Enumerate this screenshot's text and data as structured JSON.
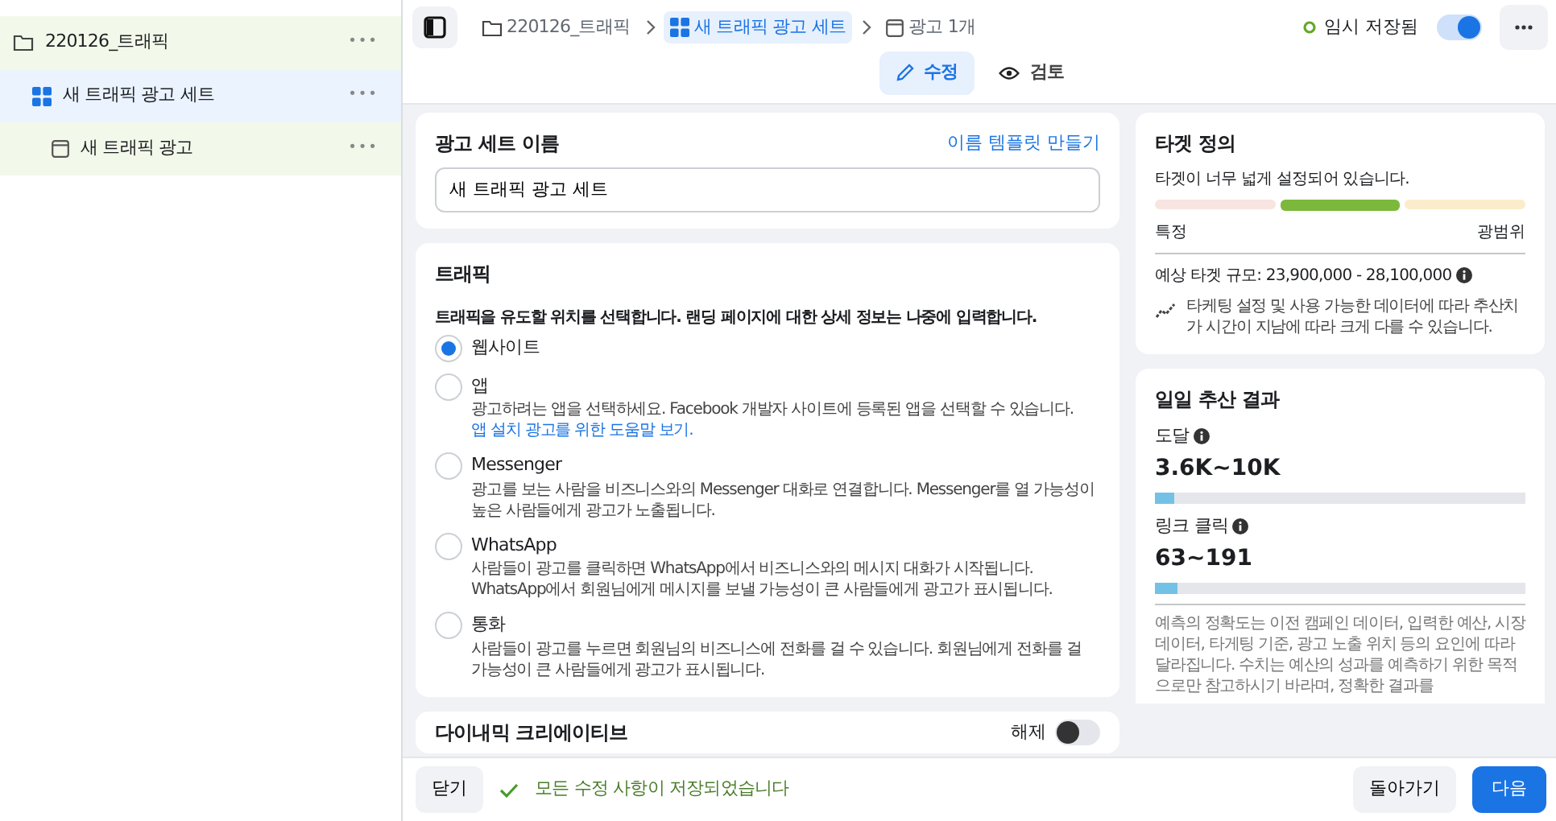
{
  "sidebar": {
    "items": [
      {
        "label": "220126_트래픽",
        "selected": false,
        "kind": "campaign",
        "more": "•••",
        "children": [
          {
            "label": "새 트래픽 광고 세트",
            "selected": true,
            "kind": "adset",
            "more": "•••",
            "children": [
              {
                "label": "새 트래픽 광고",
                "selected": false,
                "kind": "ad",
                "more": "•••"
              }
            ]
          }
        ]
      }
    ]
  },
  "header": {
    "breadcrumb": [
      {
        "label": "220126_트래픽",
        "kind": "campaign",
        "selected": false
      },
      {
        "label": "새 트래픽 광고 세트",
        "kind": "adset",
        "selected": true
      },
      {
        "label": "광고 1개",
        "kind": "ad",
        "selected": false
      }
    ],
    "save_status": "임시 저장됨",
    "toggle_on": true,
    "tabs": [
      {
        "label": "수정",
        "kind": "edit",
        "selected": true
      },
      {
        "label": "검토",
        "kind": "review",
        "selected": false
      }
    ]
  },
  "name_card": {
    "title": "광고 세트 이름",
    "link": "이름 템플릿 만들기",
    "value": "새 트래픽 광고 세트"
  },
  "traffic_card": {
    "title": "트래픽",
    "prompt": "트래픽을 유도할 위치를 선택합니다. 랜딩 페이지에 대한 상세 정보는 나중에 입력합니다.",
    "options": [
      {
        "label": "웹사이트",
        "selected": true
      },
      {
        "label": "앱",
        "selected": false,
        "description": "광고하려는 앱을 선택하세요. Facebook 개발자 사이트에 등록된 앱을 선택할 수 있습니다.",
        "link": "앱 설치 광고를 위한 도움말 보기."
      },
      {
        "label": "Messenger",
        "selected": false,
        "description": "광고를 보는 사람을 비즈니스와의 Messenger 대화로 연결합니다. Messenger를 열 가능성이 높은 사람들에게 광고가 노출됩니다."
      },
      {
        "label": "WhatsApp",
        "selected": false,
        "description": "사람들이 광고를 클릭하면 WhatsApp에서 비즈니스와의 메시지 대화가 시작됩니다. WhatsApp에서 회원님에게 메시지를 보낼 가능성이 큰 사람들에게 광고가 표시됩니다."
      },
      {
        "label": "통화",
        "selected": false,
        "description": "사람들이 광고를 누르면 회원님의 비즈니스에 전화를 걸 수 있습니다. 회원님에게 전화를 걸 가능성이 큰 사람들에게 광고가 표시됩니다."
      }
    ]
  },
  "dynamic_card": {
    "title": "다이내믹 크리에이티브",
    "toggle_label": "해제",
    "toggle_on": false
  },
  "audience_card": {
    "title": "타겟 정의",
    "status": "타겟이 너무 넓게 설정되어 있습니다.",
    "segments": [
      {
        "selected": false,
        "color": "#f8e4e1"
      },
      {
        "selected": true,
        "color": "#7cb83c"
      },
      {
        "selected": false,
        "color": "#fbeccb"
      }
    ],
    "left_label": "특정",
    "right_label": "광범위",
    "size": "예상 타겟 규모: 23,900,000 - 28,100,000",
    "note": "타케팅 설정 및 사용 가능한 데이터에 따라 추산치가 시간이 지남에 따라 크게 다를 수 있습니다."
  },
  "results_card": {
    "title": "일일 추산 결과",
    "metrics": [
      {
        "label": "도달",
        "value": "3.6K~10K",
        "level": 0.05
      },
      {
        "label": "링크 클릭",
        "value": "63~191",
        "level": 0.06
      }
    ],
    "disclaimer": "예측의 정확도는 이전 캠페인 데이터, 입력한 예산, 시장 데이터, 타게팅 기준, 광고 노출 위치 등의 요인에 따라 달라집니다. 수치는 예산의 성과를 예측하기 위한 목적으로만 참고하시기 바라며, 정확한 결과를"
  },
  "footer": {
    "close": "닫기",
    "saved": "모든 수정 사항이 저장되었습니다",
    "back": "돌아가기",
    "next": "다음"
  }
}
